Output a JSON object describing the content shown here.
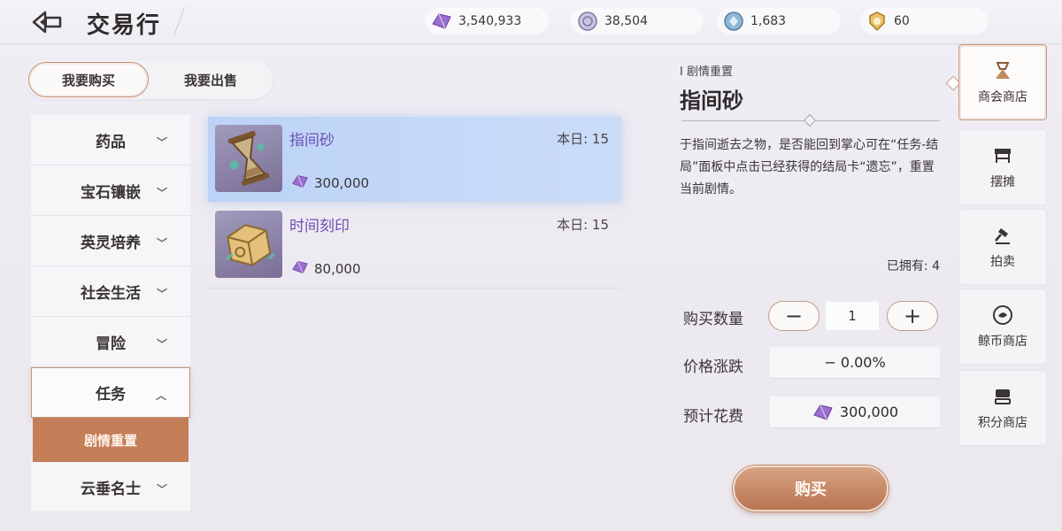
{
  "header": {
    "title": "交易行"
  },
  "currencies": [
    {
      "icon": "purple-gem-icon",
      "value": "3,540,933"
    },
    {
      "icon": "silver-coin-icon",
      "value": "38,504"
    },
    {
      "icon": "blue-crystal-icon",
      "value": "1,683"
    },
    {
      "icon": "gold-medal-icon",
      "value": "60"
    }
  ],
  "mode": {
    "buy": "我要购买",
    "sell": "我要出售",
    "active": "buy"
  },
  "categories": [
    {
      "label": "药品"
    },
    {
      "label": "宝石镶嵌"
    },
    {
      "label": "英灵培养"
    },
    {
      "label": "社会生活"
    },
    {
      "label": "冒险"
    },
    {
      "label": "任务",
      "open": true,
      "sub": [
        "剧情重置"
      ]
    },
    {
      "label": "云垂名士"
    }
  ],
  "items": [
    {
      "name": "指间砂",
      "daily": "本日: 15",
      "price": "300,000",
      "selected": true
    },
    {
      "name": "时间刻印",
      "daily": "本日: 15",
      "price": "80,000"
    }
  ],
  "detail": {
    "tag": "I 剧情重置",
    "title": "指间砂",
    "desc": "于指间逝去之物，是否能回到掌心可在“任务-结局”面板中点击已经获得的结局卡“遗忘”，重置当前剧情。",
    "owned": "已拥有: 4",
    "qty_label": "购买数量",
    "qty": "1",
    "minus": "−",
    "plus": "+",
    "change_label": "价格涨跌",
    "change": "− 0.00%",
    "cost_label": "预计花费",
    "cost": "300,000",
    "buy": "购买"
  },
  "rightnav": [
    {
      "label": "商会商店",
      "icon": "guild-shop-icon",
      "active": true
    },
    {
      "label": "摆摊",
      "icon": "stall-icon"
    },
    {
      "label": "拍卖",
      "icon": "gavel-icon"
    },
    {
      "label": "鲸币商店",
      "icon": "whale-coin-icon"
    },
    {
      "label": "积分商店",
      "icon": "points-shop-icon"
    }
  ],
  "colors": {
    "accent": "#c47e58",
    "item_name": "#6c4fb2",
    "selected_row": "#bcd3f7"
  }
}
